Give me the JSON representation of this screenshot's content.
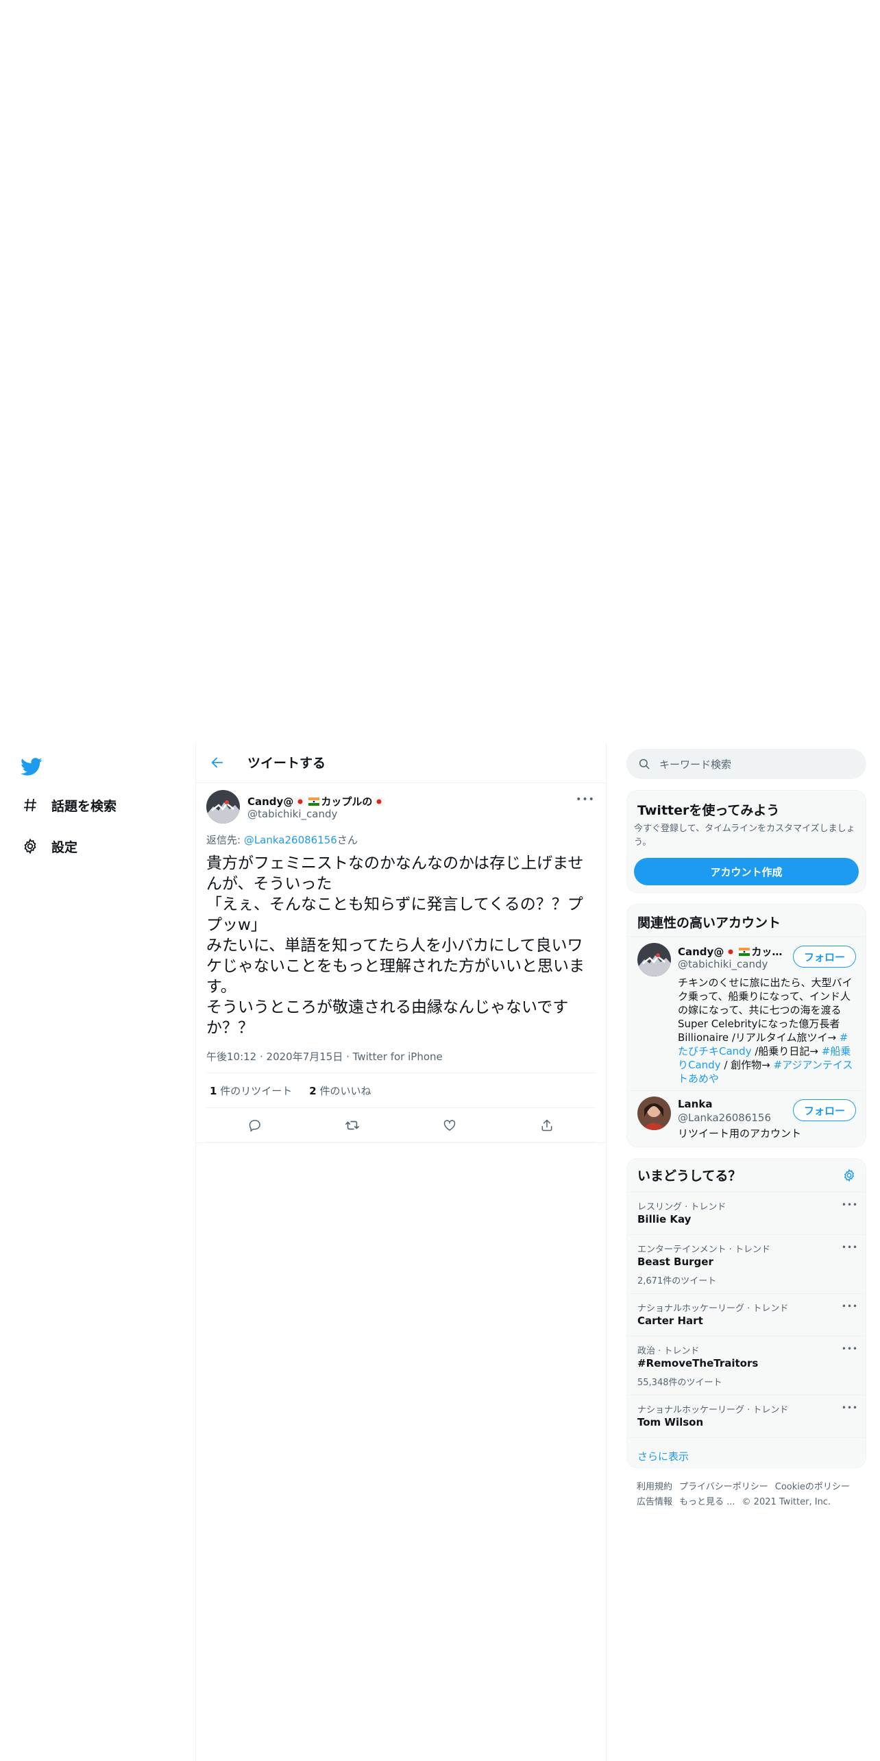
{
  "nav": {
    "items": [
      {
        "label": "話題を検索"
      },
      {
        "label": "設定"
      }
    ]
  },
  "header": {
    "title": "ツイートする"
  },
  "tweet": {
    "name": "Candy@",
    "name_suffix": "カップルの",
    "handle": "@tabichiki_candy",
    "reply_prefix": "返信先: ",
    "reply_mention": "@Lanka26086156",
    "reply_suffix": "さん",
    "text": "貴方がフェミニストなのかなんなのかは存じ上げませんが、そういった\n「えぇ、そんなことも知らずに発言してくるの？？ププッw」\nみたいに、単語を知ってたら人を小バカにして良いワケじゃないことをもっと理解された方がいいと思います。\nそういうところが敬遠される由縁なんじゃないですか？？",
    "time": "午後10:12",
    "date": "2020年7月15日",
    "source": "Twitter for iPhone",
    "retweets": "1",
    "retweets_label": "件のリツイート",
    "likes": "2",
    "likes_label": "件のいいね"
  },
  "search": {
    "placeholder": "キーワード検索"
  },
  "signup": {
    "title": "Twitterを使ってみよう",
    "subtitle": "今すぐ登録して、タイムラインをカスタマイズしましょう。",
    "button": "アカウント作成"
  },
  "relevant": {
    "title": "関連性の高いアカウント",
    "follow_label": "フォロー",
    "accounts": [
      {
        "name": "Candy@",
        "name_suffix": "カップ...",
        "handle": "@tabichiki_candy",
        "bio_1": "チキンのくせに旅に出たら、大型バイク乗って、船乗りになって、インド人の嫁になって、共に七つの海を渡るSuper Celebrityになった億万長者Billionaire /リアルタイム旅ツイ→ ",
        "bio_link_1": "#たびチキCandy",
        "bio_2": " /船乗り日記→ ",
        "bio_link_2": "#船乗りCandy",
        "bio_3": " / 創作物→ ",
        "bio_link_3": "#アジアンテイストあめや"
      },
      {
        "name": "Lanka",
        "handle": "@Lanka26086156",
        "bio": "リツイート用のアカウント"
      }
    ]
  },
  "trends": {
    "title": "いまどうしてる？",
    "items": [
      {
        "context": "レスリング · トレンド",
        "name": "Billie Kay",
        "count": ""
      },
      {
        "context": "エンターテインメント · トレンド",
        "name": "Beast Burger",
        "count": "2,671件のツイート"
      },
      {
        "context": "ナショナルホッケーリーグ · トレンド",
        "name": "Carter Hart",
        "count": ""
      },
      {
        "context": "政治 · トレンド",
        "name": "#RemoveTheTraitors",
        "count": "55,348件のツイート"
      },
      {
        "context": "ナショナルホッケーリーグ · トレンド",
        "name": "Tom Wilson",
        "count": ""
      }
    ],
    "show_more": "さらに表示"
  },
  "footer": {
    "terms": "利用規約",
    "privacy": "プライバシーポリシー",
    "cookie": "Cookieのポリシー",
    "ads": "広告情報",
    "more": "もっと見る ...",
    "copyright": "© 2021 Twitter, Inc."
  },
  "colors": {
    "accent": "#1d9bf0",
    "text": "#0f1419",
    "muted": "#536471",
    "border": "#eff3f4"
  }
}
